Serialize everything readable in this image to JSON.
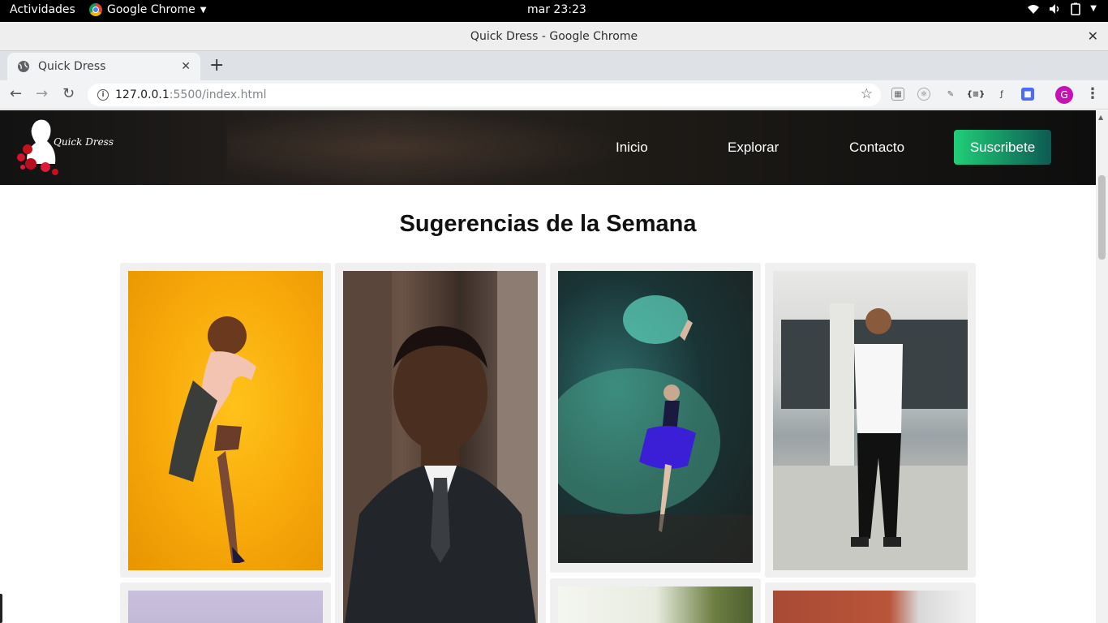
{
  "system": {
    "activities": "Actividades",
    "app_name": "Google Chrome",
    "clock": "mar 23:23"
  },
  "window": {
    "title": "Quick Dress - Google Chrome"
  },
  "browser": {
    "tab_title": "Quick Dress",
    "url_host": "127.0.0.1",
    "url_path": ":5500/index.html",
    "profile_initial": "G"
  },
  "site": {
    "logo_text": "Quick Dress",
    "nav": [
      "Inicio",
      "Explorar",
      "Contacto"
    ],
    "subscribe": "Suscribete",
    "section_title": "Sugerencias de la Semana",
    "accent_gradient": [
      "#1fcf78",
      "#0e5a52"
    ]
  }
}
